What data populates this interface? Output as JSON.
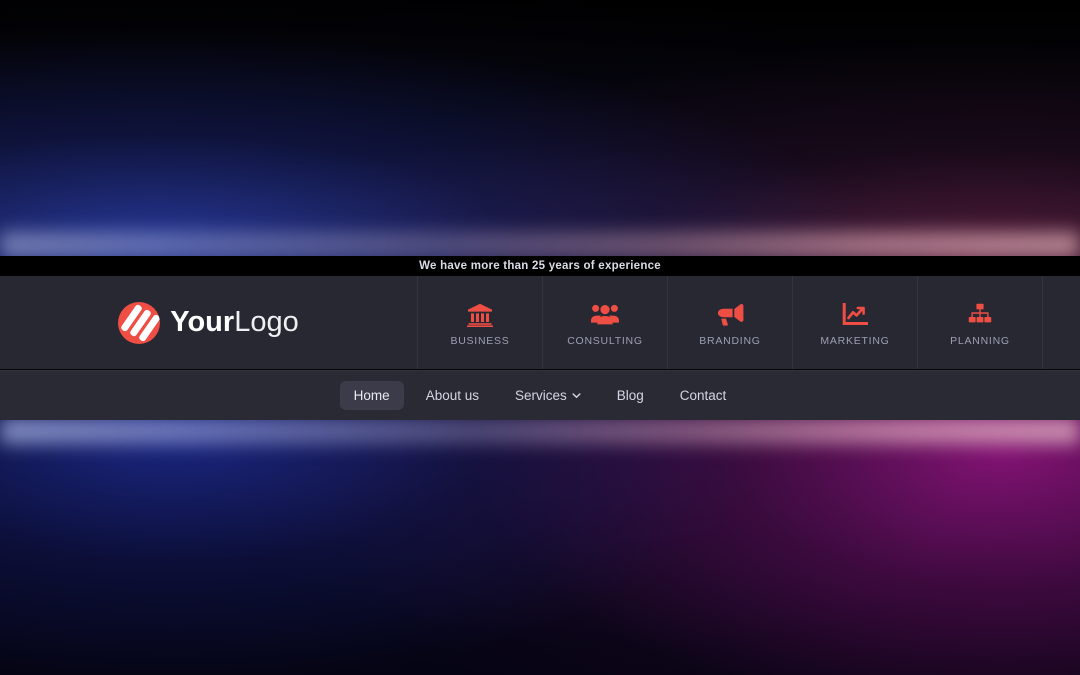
{
  "announcement": {
    "tagline": "We have more than 25 years of experience"
  },
  "brand": {
    "name_bold": "Your",
    "name_light": "Logo",
    "mark_icon": "slashes-circle-logo-icon",
    "accent_color": "#ef4e44"
  },
  "services": [
    {
      "label": "BUSINESS",
      "icon": "bank-icon"
    },
    {
      "label": "CONSULTING",
      "icon": "users-group-icon"
    },
    {
      "label": "BRANDING",
      "icon": "bullhorn-icon"
    },
    {
      "label": "MARKETING",
      "icon": "chart-line-up-icon"
    },
    {
      "label": "PLANNING",
      "icon": "sitemap-icon"
    }
  ],
  "nav": {
    "items": [
      {
        "label": "Home",
        "active": true,
        "has_dropdown": false
      },
      {
        "label": "About us",
        "active": false,
        "has_dropdown": false
      },
      {
        "label": "Services",
        "active": false,
        "has_dropdown": true,
        "dropdown_icon": "chevron-down-icon"
      },
      {
        "label": "Blog",
        "active": false,
        "has_dropdown": false
      },
      {
        "label": "Contact",
        "active": false,
        "has_dropdown": false
      }
    ]
  },
  "theme": {
    "header_bg": "#282832",
    "nav_bg": "#2a2a35",
    "topbar_bg": "#000000",
    "accent": "#ef4e44",
    "label_color": "#9aa0b4"
  }
}
